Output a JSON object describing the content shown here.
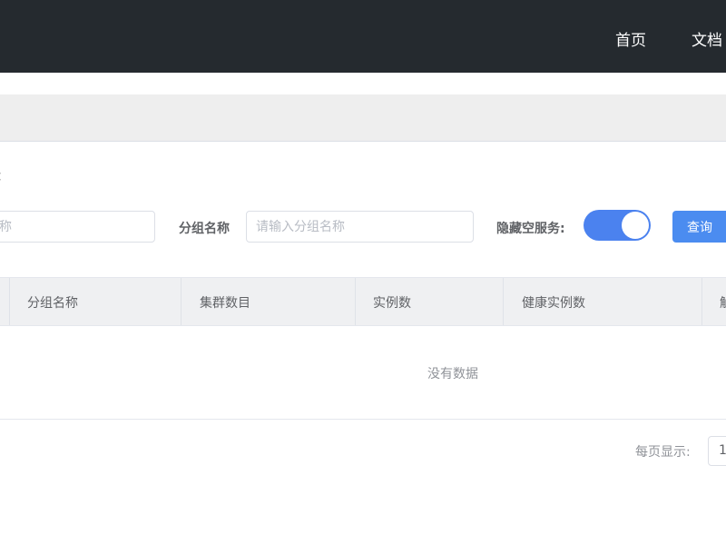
{
  "header": {
    "nav": [
      {
        "label": "首页"
      },
      {
        "label": "文档"
      }
    ]
  },
  "page": {
    "title_fragment": "c"
  },
  "filters": {
    "service_name_placeholder_fragment": "务名称",
    "group_name_label": "分组名称",
    "group_name_placeholder": "请输入分组名称",
    "hide_empty_label": "隐藏空服务:",
    "hide_empty_value": true,
    "query_label": "查询"
  },
  "table": {
    "columns": [
      "分组名称",
      "集群数目",
      "实例数",
      "健康实例数",
      "触"
    ],
    "empty_text": "没有数据"
  },
  "pagination": {
    "page_size_label": "每页显示:",
    "page_size_value_fragment": "1"
  },
  "colors": {
    "topbar": "#252a2f",
    "primary": "#4b82ef",
    "header_bg": "#eff0f2"
  }
}
